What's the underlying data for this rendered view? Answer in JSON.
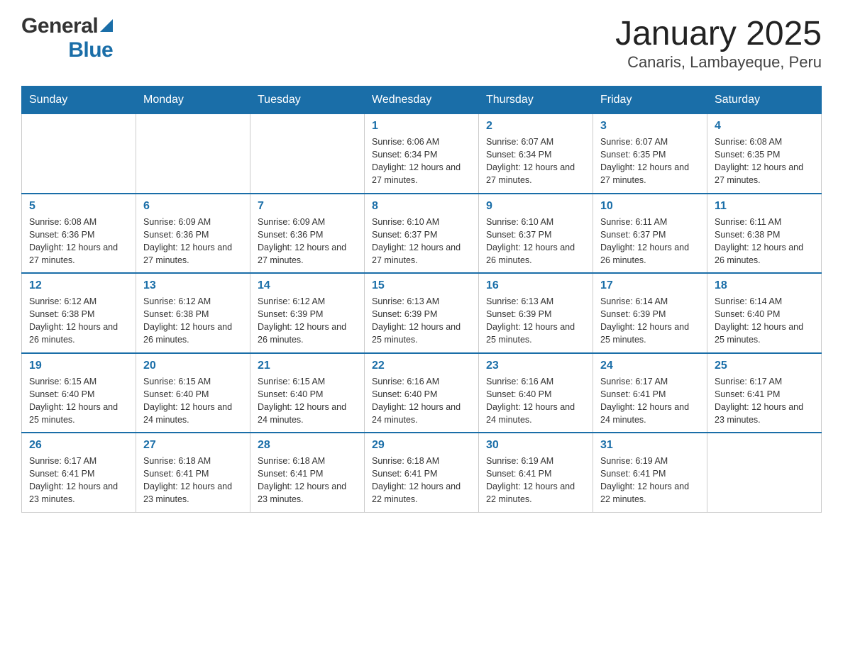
{
  "header": {
    "title": "January 2025",
    "subtitle": "Canaris, Lambayeque, Peru"
  },
  "logo": {
    "general": "General",
    "blue": "Blue"
  },
  "days": [
    "Sunday",
    "Monday",
    "Tuesday",
    "Wednesday",
    "Thursday",
    "Friday",
    "Saturday"
  ],
  "weeks": [
    [
      {
        "day": "",
        "info": ""
      },
      {
        "day": "",
        "info": ""
      },
      {
        "day": "",
        "info": ""
      },
      {
        "day": "1",
        "info": "Sunrise: 6:06 AM\nSunset: 6:34 PM\nDaylight: 12 hours and 27 minutes."
      },
      {
        "day": "2",
        "info": "Sunrise: 6:07 AM\nSunset: 6:34 PM\nDaylight: 12 hours and 27 minutes."
      },
      {
        "day": "3",
        "info": "Sunrise: 6:07 AM\nSunset: 6:35 PM\nDaylight: 12 hours and 27 minutes."
      },
      {
        "day": "4",
        "info": "Sunrise: 6:08 AM\nSunset: 6:35 PM\nDaylight: 12 hours and 27 minutes."
      }
    ],
    [
      {
        "day": "5",
        "info": "Sunrise: 6:08 AM\nSunset: 6:36 PM\nDaylight: 12 hours and 27 minutes."
      },
      {
        "day": "6",
        "info": "Sunrise: 6:09 AM\nSunset: 6:36 PM\nDaylight: 12 hours and 27 minutes."
      },
      {
        "day": "7",
        "info": "Sunrise: 6:09 AM\nSunset: 6:36 PM\nDaylight: 12 hours and 27 minutes."
      },
      {
        "day": "8",
        "info": "Sunrise: 6:10 AM\nSunset: 6:37 PM\nDaylight: 12 hours and 27 minutes."
      },
      {
        "day": "9",
        "info": "Sunrise: 6:10 AM\nSunset: 6:37 PM\nDaylight: 12 hours and 26 minutes."
      },
      {
        "day": "10",
        "info": "Sunrise: 6:11 AM\nSunset: 6:37 PM\nDaylight: 12 hours and 26 minutes."
      },
      {
        "day": "11",
        "info": "Sunrise: 6:11 AM\nSunset: 6:38 PM\nDaylight: 12 hours and 26 minutes."
      }
    ],
    [
      {
        "day": "12",
        "info": "Sunrise: 6:12 AM\nSunset: 6:38 PM\nDaylight: 12 hours and 26 minutes."
      },
      {
        "day": "13",
        "info": "Sunrise: 6:12 AM\nSunset: 6:38 PM\nDaylight: 12 hours and 26 minutes."
      },
      {
        "day": "14",
        "info": "Sunrise: 6:12 AM\nSunset: 6:39 PM\nDaylight: 12 hours and 26 minutes."
      },
      {
        "day": "15",
        "info": "Sunrise: 6:13 AM\nSunset: 6:39 PM\nDaylight: 12 hours and 25 minutes."
      },
      {
        "day": "16",
        "info": "Sunrise: 6:13 AM\nSunset: 6:39 PM\nDaylight: 12 hours and 25 minutes."
      },
      {
        "day": "17",
        "info": "Sunrise: 6:14 AM\nSunset: 6:39 PM\nDaylight: 12 hours and 25 minutes."
      },
      {
        "day": "18",
        "info": "Sunrise: 6:14 AM\nSunset: 6:40 PM\nDaylight: 12 hours and 25 minutes."
      }
    ],
    [
      {
        "day": "19",
        "info": "Sunrise: 6:15 AM\nSunset: 6:40 PM\nDaylight: 12 hours and 25 minutes."
      },
      {
        "day": "20",
        "info": "Sunrise: 6:15 AM\nSunset: 6:40 PM\nDaylight: 12 hours and 24 minutes."
      },
      {
        "day": "21",
        "info": "Sunrise: 6:15 AM\nSunset: 6:40 PM\nDaylight: 12 hours and 24 minutes."
      },
      {
        "day": "22",
        "info": "Sunrise: 6:16 AM\nSunset: 6:40 PM\nDaylight: 12 hours and 24 minutes."
      },
      {
        "day": "23",
        "info": "Sunrise: 6:16 AM\nSunset: 6:40 PM\nDaylight: 12 hours and 24 minutes."
      },
      {
        "day": "24",
        "info": "Sunrise: 6:17 AM\nSunset: 6:41 PM\nDaylight: 12 hours and 24 minutes."
      },
      {
        "day": "25",
        "info": "Sunrise: 6:17 AM\nSunset: 6:41 PM\nDaylight: 12 hours and 23 minutes."
      }
    ],
    [
      {
        "day": "26",
        "info": "Sunrise: 6:17 AM\nSunset: 6:41 PM\nDaylight: 12 hours and 23 minutes."
      },
      {
        "day": "27",
        "info": "Sunrise: 6:18 AM\nSunset: 6:41 PM\nDaylight: 12 hours and 23 minutes."
      },
      {
        "day": "28",
        "info": "Sunrise: 6:18 AM\nSunset: 6:41 PM\nDaylight: 12 hours and 23 minutes."
      },
      {
        "day": "29",
        "info": "Sunrise: 6:18 AM\nSunset: 6:41 PM\nDaylight: 12 hours and 22 minutes."
      },
      {
        "day": "30",
        "info": "Sunrise: 6:19 AM\nSunset: 6:41 PM\nDaylight: 12 hours and 22 minutes."
      },
      {
        "day": "31",
        "info": "Sunrise: 6:19 AM\nSunset: 6:41 PM\nDaylight: 12 hours and 22 minutes."
      },
      {
        "day": "",
        "info": ""
      }
    ]
  ]
}
